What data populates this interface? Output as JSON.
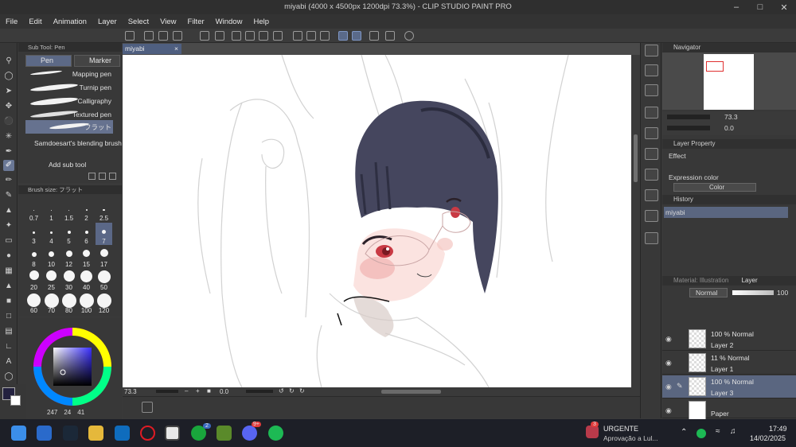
{
  "window": {
    "title": "miyabi (4000 x 4500px 1200dpi 73.3%)  - CLIP STUDIO PAINT PRO",
    "controls": [
      "minimize-icon",
      "maximize-icon",
      "close-icon"
    ]
  },
  "menu": [
    "File",
    "Edit",
    "Animation",
    "Layer",
    "Select",
    "View",
    "Filter",
    "Window",
    "Help"
  ],
  "subtool": {
    "header": "Sub Tool: Pen",
    "tabs": [
      "Pen",
      "Marker"
    ],
    "brushes": [
      "Mapping pen",
      "Turnip pen",
      "Calligraphy",
      "Textured pen",
      "フラット"
    ],
    "selected_brush": "フラット",
    "extra_item": "Samdoesart's blending brush",
    "add_label": "Add sub tool"
  },
  "brush_size": {
    "header": "Brush size: フラット",
    "sizes": [
      "0.7",
      "1",
      "1.5",
      "2",
      "2.5",
      "3",
      "4",
      "5",
      "6",
      "7",
      "8",
      "10",
      "12",
      "15",
      "17",
      "20",
      "25",
      "30",
      "40",
      "50",
      "60",
      "70",
      "80",
      "100",
      "120"
    ],
    "selected": "7"
  },
  "color": {
    "main": "#23213f",
    "sub": "#ffffff",
    "readout": [
      "247",
      "24",
      "41"
    ]
  },
  "document": {
    "tab": "miyabi",
    "zoom": "73.3",
    "rotation": "0.0"
  },
  "navigator": {
    "header": "Navigator",
    "zoom": "73.3",
    "rotation": "0.0"
  },
  "layer_property": {
    "header": "Layer Property",
    "effect_label": "Effect",
    "expression_label": "Expression color",
    "expression_value": "Color"
  },
  "history": {
    "header": "History",
    "items": [
      "miyabi"
    ]
  },
  "layers": {
    "tabs": [
      "Material: Illustration",
      "Layer"
    ],
    "blend_mode": "Normal",
    "opacity": "100",
    "rows": [
      {
        "opacity": "100 % Normal",
        "name": "Layer 2",
        "selected": false
      },
      {
        "opacity": "11 % Normal",
        "name": "Layer 1",
        "selected": false
      },
      {
        "opacity": "100 % Normal",
        "name": "Layer 3",
        "selected": true
      },
      {
        "opacity": "",
        "name": "Paper",
        "selected": false
      }
    ]
  },
  "taskbar": {
    "notification_title": "URGENTE",
    "notification_text": "Aprovação a Lul...",
    "notification_badge": "3",
    "xbox_badge": "2",
    "discord_badge": "9+",
    "time": "17:49",
    "date": "14/02/2025"
  }
}
